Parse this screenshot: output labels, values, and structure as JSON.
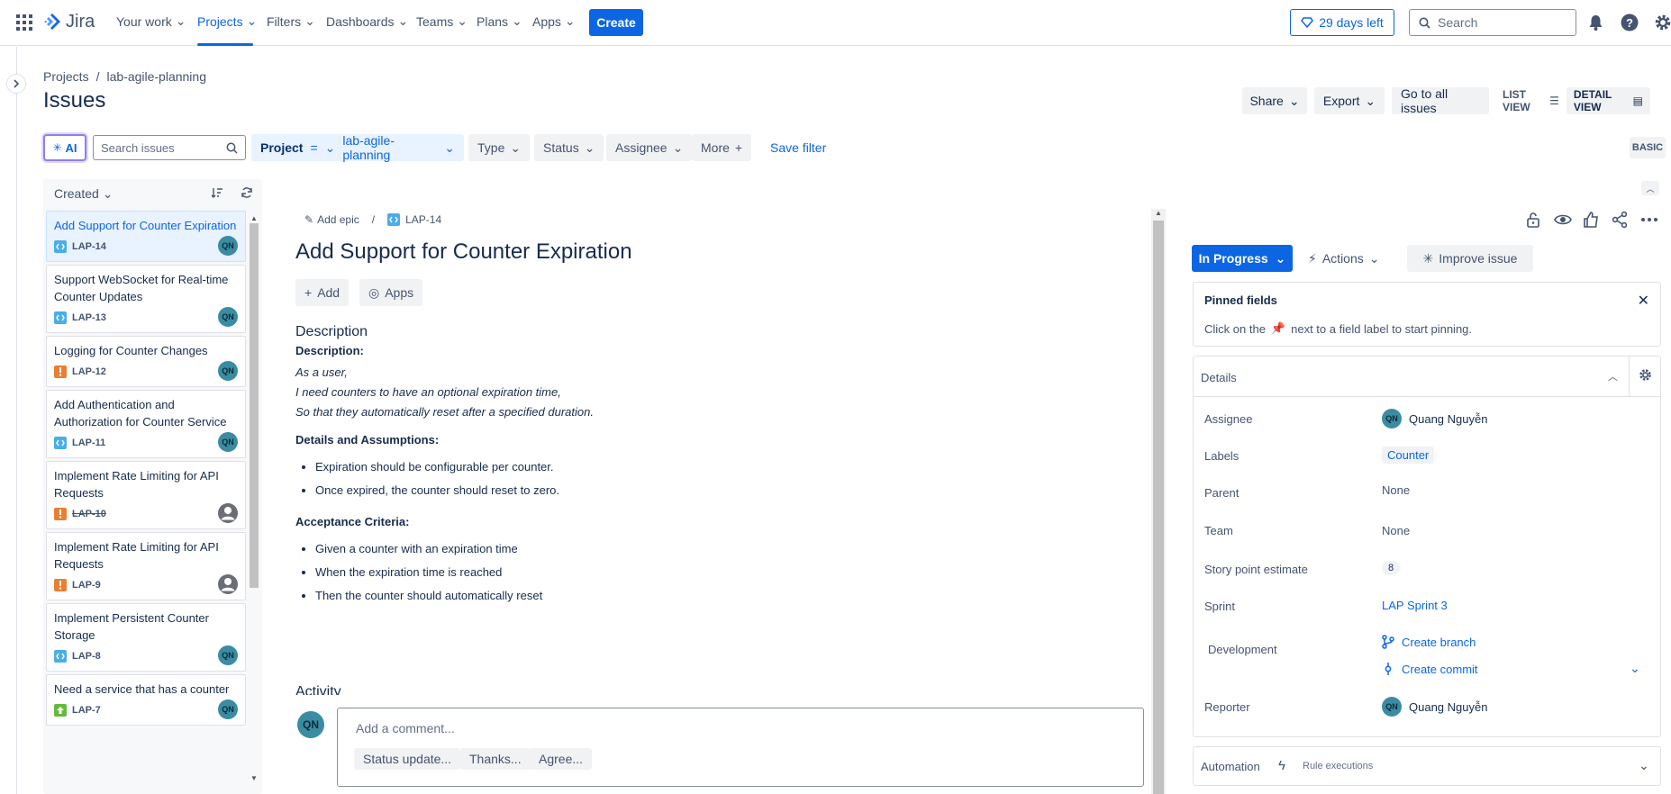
{
  "app": {
    "name": "Jira"
  },
  "nav": {
    "items": [
      "Your work",
      "Projects",
      "Filters",
      "Dashboards",
      "Teams",
      "Plans",
      "Apps"
    ],
    "create": "Create",
    "trial": "29 days left",
    "search_placeholder": "Search"
  },
  "breadcrumb": {
    "root": "Projects",
    "sep": "/",
    "project": "lab-agile-planning"
  },
  "page_title": "Issues",
  "header_actions": {
    "share": "Share",
    "export": "Export",
    "all_issues": "Go to all issues",
    "list_view": "LIST VIEW",
    "detail_view": "DETAIL VIEW"
  },
  "filters": {
    "ai": "AI",
    "search_placeholder": "Search issues",
    "project_label": "Project",
    "project_op": "=",
    "project_value": "lab-agile-planning",
    "type": "Type",
    "status": "Status",
    "assignee": "Assignee",
    "more": "More",
    "save": "Save filter",
    "basic": "BASIC"
  },
  "list": {
    "sort": "Created",
    "items": [
      {
        "title": "Add Support for Counter Expiration",
        "key": "LAP-14",
        "type": "story",
        "assignee": "QN",
        "done": false
      },
      {
        "title": "Support WebSocket for Real-time Counter Updates",
        "key": "LAP-13",
        "type": "story",
        "assignee": "QN",
        "done": false
      },
      {
        "title": "Logging for Counter Changes",
        "key": "LAP-12",
        "type": "bug",
        "assignee": "QN",
        "done": false
      },
      {
        "title": "Add Authentication and Authorization for Counter Service",
        "key": "LAP-11",
        "type": "story",
        "assignee": "QN",
        "done": false
      },
      {
        "title": "Implement Rate Limiting for API Requests",
        "key": "LAP-10",
        "type": "bug",
        "assignee": "",
        "done": true
      },
      {
        "title": "Implement Rate Limiting for API Requests",
        "key": "LAP-9",
        "type": "bug",
        "assignee": "",
        "done": false
      },
      {
        "title": "Implement Persistent Counter Storage",
        "key": "LAP-8",
        "type": "story",
        "assignee": "QN",
        "done": false
      },
      {
        "title": "Need a service that has a counter",
        "key": "LAP-7",
        "type": "improvement",
        "assignee": "QN",
        "done": false
      }
    ]
  },
  "issue": {
    "epic": "Add epic",
    "key": "LAP-14",
    "title": "Add Support for Counter Expiration",
    "add": "Add",
    "apps": "Apps",
    "description_heading": "Description",
    "description_label": "Description:",
    "story_lines": [
      "As a user,",
      "I need counters to have an optional expiration time,",
      "So that they automatically reset after a specified duration."
    ],
    "assumptions_heading": "Details and Assumptions:",
    "assumptions": [
      "Expiration should be configurable per counter.",
      "Once expired, the counter should reset to zero."
    ],
    "criteria_heading": "Acceptance Criteria:",
    "criteria": [
      "Given a counter with an expiration time",
      "When the expiration time is reached",
      "Then the counter should automatically reset"
    ],
    "activity": "Activity",
    "comment_avatar": "QN",
    "comment_placeholder": "Add a comment...",
    "quick_replies": [
      "Status update...",
      "Thanks...",
      "Agree..."
    ]
  },
  "side": {
    "status": "In Progress",
    "actions": "Actions",
    "improve": "Improve issue",
    "pinned_title": "Pinned fields",
    "pinned_text_before": "Click on the",
    "pinned_text_after": "next to a field label to start pinning.",
    "details_title": "Details",
    "fields": {
      "assignee_label": "Assignee",
      "assignee": "Quang Nguyễn",
      "assignee_initials": "QN",
      "labels_label": "Labels",
      "labels": "Counter",
      "parent_label": "Parent",
      "parent": "None",
      "team_label": "Team",
      "team": "None",
      "sp_label": "Story point estimate",
      "sp": "8",
      "sprint_label": "Sprint",
      "sprint": "LAP Sprint 3",
      "dev_label": "Development",
      "branch": "Create branch",
      "commit": "Create commit",
      "reporter_label": "Reporter",
      "reporter": "Quang Nguyễn",
      "reporter_initials": "QN"
    },
    "automation": "Automation",
    "rule_exec": "Rule executions"
  },
  "colors": {
    "accent": "#0c66e4",
    "story": "#4bade8",
    "bug": "#e97f33",
    "improvement": "#63ba3c"
  }
}
